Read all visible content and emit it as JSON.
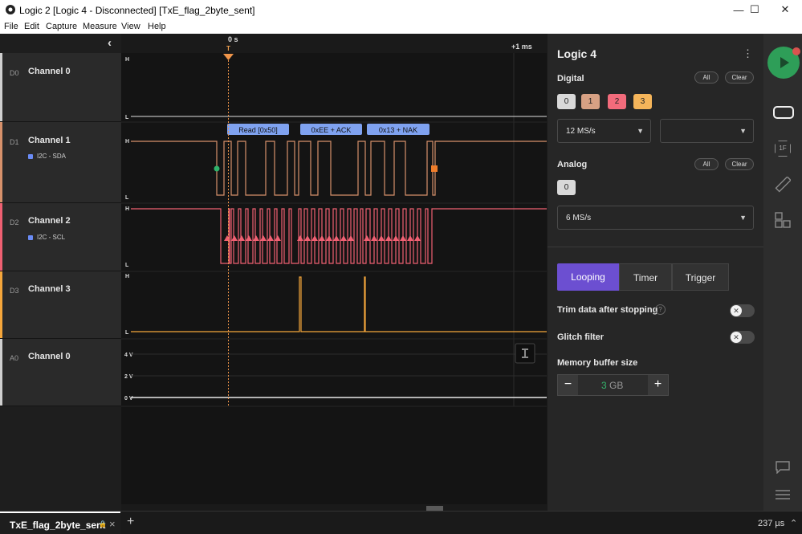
{
  "window": {
    "title": "Logic 2 [Logic 4 - Disconnected] [TxE_flag_2byte_sent]",
    "min_glyph": "—",
    "max_glyph": "☐",
    "close_glyph": "✕"
  },
  "menu": [
    "File",
    "Edit",
    "Capture",
    "Measure",
    "View",
    "Help"
  ],
  "timeline": {
    "collapse_glyph": "‹",
    "t0_label": "0 s",
    "trigger_label": "T",
    "plus_label": "+1 ms"
  },
  "channels": [
    {
      "id": "D0",
      "name": "Channel 0",
      "color": "#cfcfcf"
    },
    {
      "id": "D1",
      "name": "Channel 1",
      "color": "#d7916b",
      "protocol": "I2C - SDA"
    },
    {
      "id": "D2",
      "name": "Channel 2",
      "color": "#ef6072",
      "protocol": "I2C - SCL"
    },
    {
      "id": "D3",
      "name": "Channel 3",
      "color": "#f5a63b"
    },
    {
      "id": "A0",
      "name": "Channel 0",
      "color": "#cfcfcf"
    }
  ],
  "level_labels": {
    "high": "H",
    "low": "L"
  },
  "analog_labels": [
    "4 V",
    "2 V",
    "0 V"
  ],
  "decodes": [
    "Read [0x50]",
    "0xEE + ACK",
    "0x13 + NAK"
  ],
  "panel": {
    "device": "Logic 4",
    "more_glyph": "⋮",
    "digital_label": "Digital",
    "all_label": "All",
    "clear_label": "Clear",
    "digital_channels": [
      {
        "label": "0",
        "color": "#d9d9d9"
      },
      {
        "label": "1",
        "color": "#d7a184"
      },
      {
        "label": "2",
        "color": "#f26b7b"
      },
      {
        "label": "3",
        "color": "#f5b55a"
      }
    ],
    "digital_rate": "12 MS/s",
    "digital_rate2": "",
    "analog_label": "Analog",
    "analog_channels": [
      "0"
    ],
    "analog_rate": "6 MS/s",
    "modes": [
      "Looping",
      "Timer",
      "Trigger"
    ],
    "active_mode": "Looping",
    "trim_label": "Trim data after stopping",
    "trim_help": "?",
    "glitch_label": "Glitch filter",
    "memory_label": "Memory buffer size",
    "memory_value": "3",
    "memory_unit": "GB",
    "minus": "−",
    "plus": "+",
    "colors": {
      "accent": "#6c4fd1",
      "play": "#2e9e58",
      "dot": "#d9534f"
    }
  },
  "sidebar_icons": [
    "play-icon",
    "device-icon",
    "analyzer-icon",
    "measure-icon",
    "extensions-icon",
    "feedback-icon",
    "menu-icon"
  ],
  "sidebar_text": {
    "analyzer": "1F"
  },
  "status": {
    "tab_name": "TxE_flag_2byte_sent",
    "lock_glyph": "🔒",
    "close_glyph": "×",
    "add_glyph": "+",
    "time": "237 µs",
    "expand_glyph": "⌃"
  }
}
